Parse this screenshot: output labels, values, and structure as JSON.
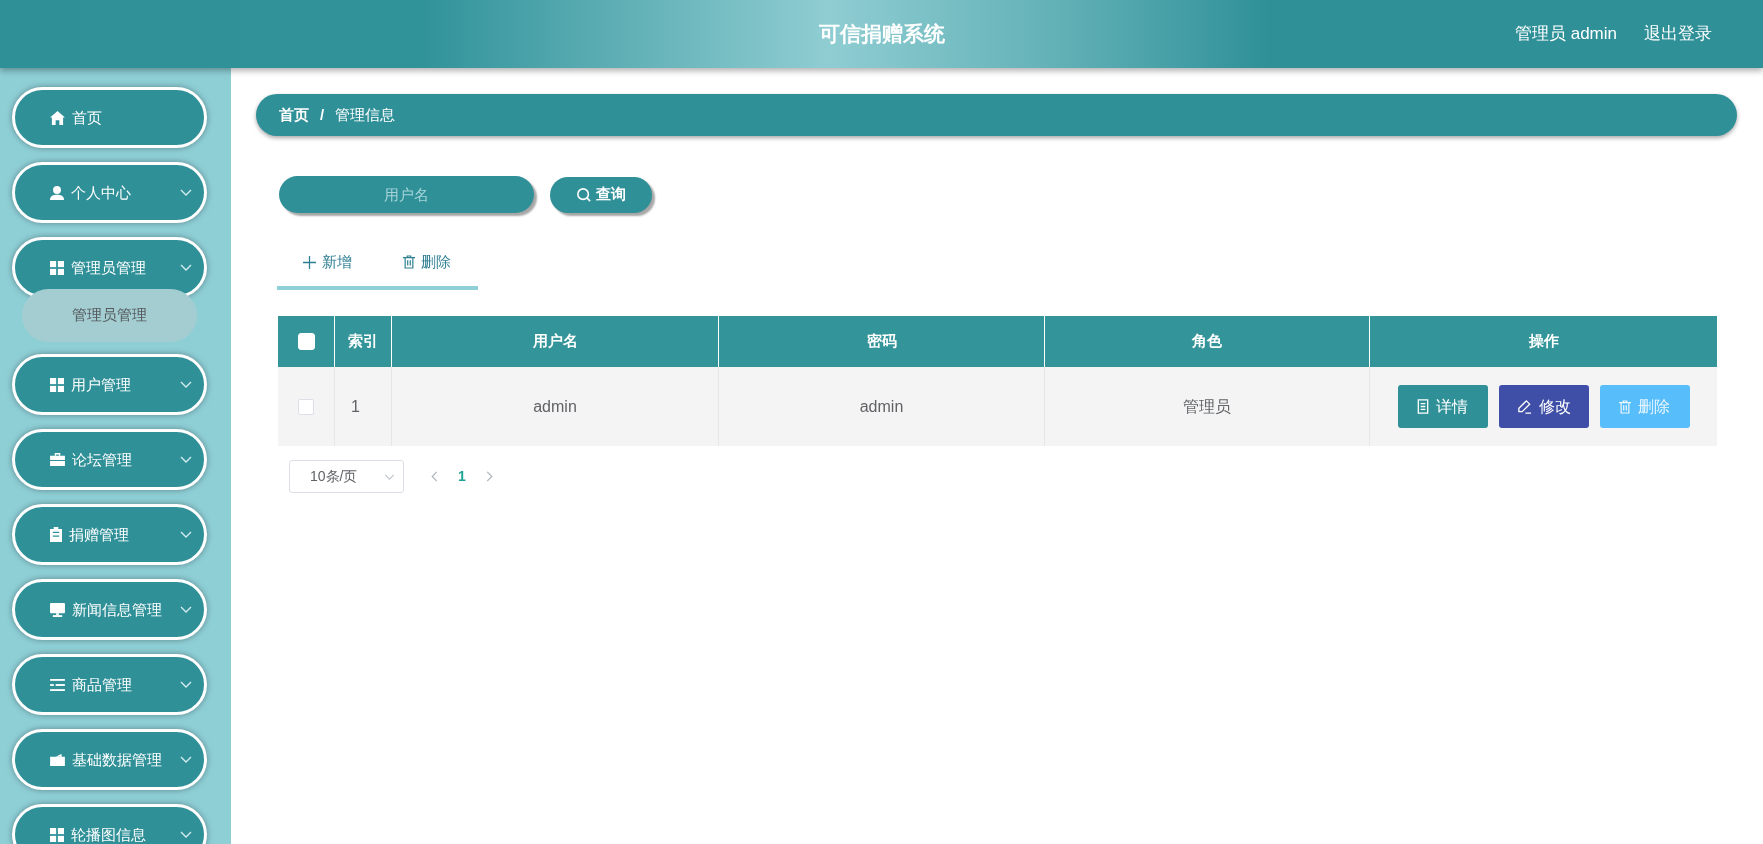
{
  "header": {
    "title": "可信捐赠系统",
    "user": "管理员 admin",
    "logout": "退出登录"
  },
  "sidebar": {
    "items": [
      {
        "label": "首页",
        "kind": "link"
      },
      {
        "label": "个人中心",
        "kind": "submenu"
      },
      {
        "label": "管理员管理",
        "kind": "submenu",
        "children": [
          {
            "label": "管理员管理"
          }
        ]
      },
      {
        "label": "用户管理",
        "kind": "submenu"
      },
      {
        "label": "论坛管理",
        "kind": "submenu"
      },
      {
        "label": "捐赠管理",
        "kind": "submenu"
      },
      {
        "label": "新闻信息管理",
        "kind": "submenu"
      },
      {
        "label": "商品管理",
        "kind": "submenu"
      },
      {
        "label": "基础数据管理",
        "kind": "submenu"
      },
      {
        "label": "轮播图信息",
        "kind": "submenu"
      }
    ]
  },
  "breadcrumb": {
    "items": [
      "首页",
      "管理信息"
    ],
    "separator": "/"
  },
  "search": {
    "placeholder": "用户名",
    "button": "查询"
  },
  "toolbar": [
    {
      "label": "新增",
      "kind": "add"
    },
    {
      "label": "删除",
      "kind": "delete"
    }
  ],
  "table": {
    "select_all": {
      "checked": false
    },
    "columns": [
      "索引",
      "用户名",
      "密码",
      "角色",
      "操作"
    ],
    "rows": [
      {
        "checked": false,
        "cells": [
          "1",
          "admin",
          "admin",
          "管理员"
        ],
        "actions": [
          {
            "label": "详情",
            "kind": "detail"
          },
          {
            "label": "修改",
            "kind": "edit"
          },
          {
            "label": "删除",
            "kind": "delete"
          }
        ]
      }
    ]
  },
  "pagination": {
    "page_size": "10条/页",
    "pages": [
      {
        "label": "1",
        "selected": true
      }
    ]
  }
}
